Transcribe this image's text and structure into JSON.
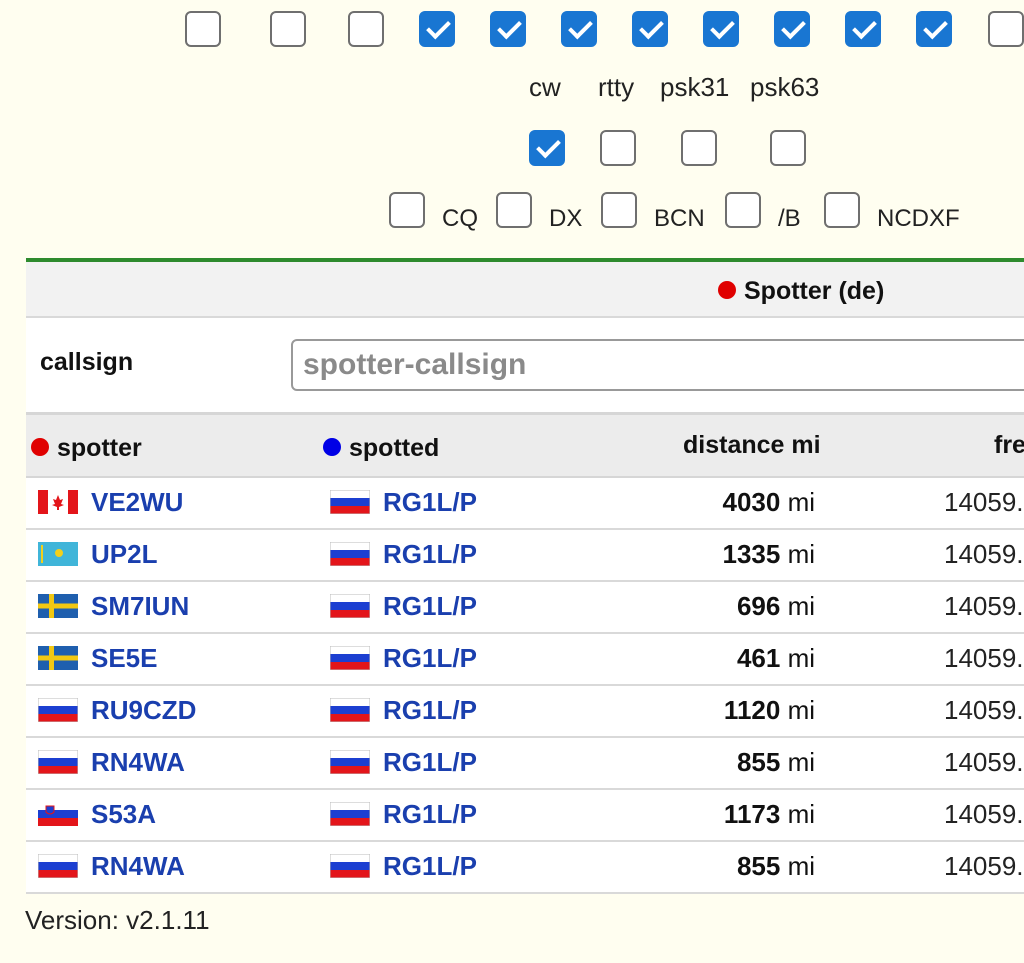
{
  "band_checkboxes": [
    false,
    false,
    false,
    true,
    true,
    true,
    true,
    true,
    true,
    true,
    true,
    false
  ],
  "modes": [
    {
      "label": "cw",
      "checked": true
    },
    {
      "label": "rtty",
      "checked": false
    },
    {
      "label": "psk31",
      "checked": false
    },
    {
      "label": "psk63",
      "checked": false
    }
  ],
  "filters": [
    {
      "label": "CQ",
      "checked": false
    },
    {
      "label": "DX",
      "checked": false
    },
    {
      "label": "BCN",
      "checked": false
    },
    {
      "label": "/B",
      "checked": false
    },
    {
      "label": "NCDXF",
      "checked": false
    }
  ],
  "spotter_section": {
    "title": "Spotter (de)"
  },
  "callsign_filter": {
    "label": "callsign",
    "placeholder": "spotter-callsign",
    "value": ""
  },
  "table": {
    "headers": {
      "spotter": "spotter",
      "spotted": "spotted",
      "distance": "distance mi",
      "freq": "fre"
    },
    "rows": [
      {
        "spotter_flag": "Canada",
        "spotter": "VE2WU",
        "spotted_flag": "Russia",
        "spotted": "RG1L/P",
        "distance": "4030",
        "unit": "mi",
        "freq": "14059."
      },
      {
        "spotter_flag": "Kazakhstan",
        "spotter": "UP2L",
        "spotted_flag": "Russia",
        "spotted": "RG1L/P",
        "distance": "1335",
        "unit": "mi",
        "freq": "14059."
      },
      {
        "spotter_flag": "Sweden",
        "spotter": "SM7IUN",
        "spotted_flag": "Russia",
        "spotted": "RG1L/P",
        "distance": "696",
        "unit": "mi",
        "freq": "14059."
      },
      {
        "spotter_flag": "Sweden",
        "spotter": "SE5E",
        "spotted_flag": "Russia",
        "spotted": "RG1L/P",
        "distance": "461",
        "unit": "mi",
        "freq": "14059."
      },
      {
        "spotter_flag": "Russia",
        "spotter": "RU9CZD",
        "spotted_flag": "Russia",
        "spotted": "RG1L/P",
        "distance": "1120",
        "unit": "mi",
        "freq": "14059."
      },
      {
        "spotter_flag": "Russia",
        "spotter": "RN4WA",
        "spotted_flag": "Russia",
        "spotted": "RG1L/P",
        "distance": "855",
        "unit": "mi",
        "freq": "14059."
      },
      {
        "spotter_flag": "Slovenia",
        "spotter": "S53A",
        "spotted_flag": "Russia",
        "spotted": "RG1L/P",
        "distance": "1173",
        "unit": "mi",
        "freq": "14059."
      },
      {
        "spotter_flag": "Russia",
        "spotter": "RN4WA",
        "spotted_flag": "Russia",
        "spotted": "RG1L/P",
        "distance": "855",
        "unit": "mi",
        "freq": "14059."
      }
    ]
  },
  "footer": {
    "version": "Version: v2.1.11"
  },
  "colors": {
    "accent": "#1976d2",
    "link": "#1a3fae",
    "rule": "#2e8b2e",
    "spotter_dot": "#e00000",
    "spotted_dot": "#0000e6",
    "background": "#fffef0"
  }
}
